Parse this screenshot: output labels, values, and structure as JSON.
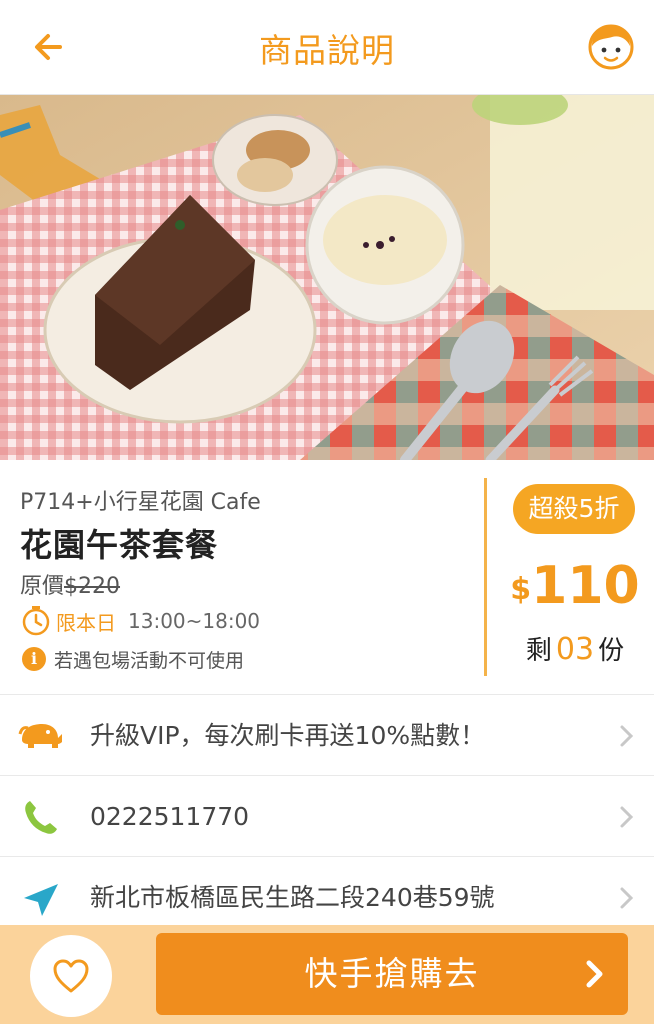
{
  "header": {
    "title": "商品說明",
    "back_icon": "back-arrow-icon",
    "avatar_icon": "user-avatar-icon"
  },
  "product": {
    "store": "P714+小行星花園 Cafe",
    "name": "花園午茶套餐",
    "original_label": "原價",
    "original_price": "$220",
    "today_label": "限本日",
    "hours": "13:00~18:00",
    "note": "若遇包場活動不可使用",
    "discount_badge": "超殺5折",
    "price_symbol": "$",
    "price": "110",
    "remain_prefix": "剩",
    "remain_count": "03",
    "remain_suffix": "份"
  },
  "rows": [
    {
      "icon": "elephant-icon",
      "text": "升級VIP，每次刷卡再送10%點數！"
    },
    {
      "icon": "phone-icon",
      "text": "0222511770"
    },
    {
      "icon": "location-arrow-icon",
      "text": "新北市板橋區民生路二段240巷59號"
    }
  ],
  "bottom": {
    "buy_label": "快手搶購去",
    "favorite_icon": "heart-icon"
  },
  "colors": {
    "accent": "#f39a1e",
    "bottom_bar": "#fbd39b",
    "buy_button": "#f08d1d",
    "phone_green": "#8cc63f",
    "location_teal": "#29a7c9"
  }
}
